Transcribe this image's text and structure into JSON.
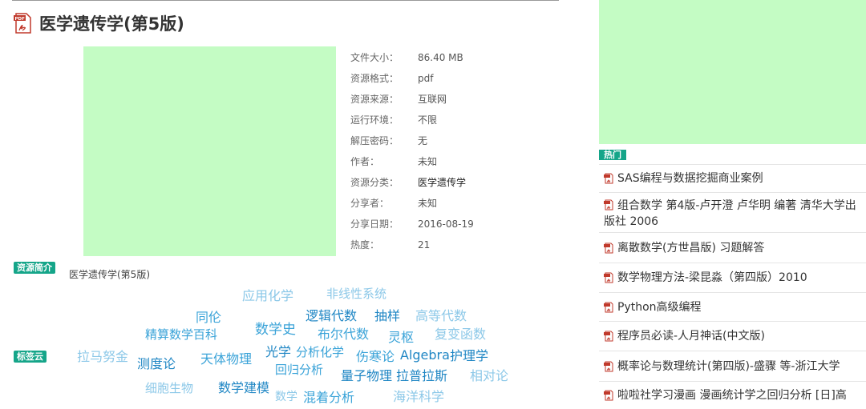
{
  "title": "医学遗传学(第5版)",
  "details": [
    {
      "label": "文件大小：",
      "value": "86.40 MB"
    },
    {
      "label": "资源格式：",
      "value": "pdf"
    },
    {
      "label": "资源来源：",
      "value": "互联网"
    },
    {
      "label": "运行环境：",
      "value": "不限"
    },
    {
      "label": "解压密码：",
      "value": "无"
    },
    {
      "label": "作者：",
      "value": "未知"
    },
    {
      "label": "资源分类：",
      "value": "医学遗传学"
    },
    {
      "label": "分享者：",
      "value": "未知"
    },
    {
      "label": "分享日期：",
      "value": "2016-08-19"
    },
    {
      "label": "热度：",
      "value": "21"
    }
  ],
  "intro": {
    "badge": "资源简介",
    "text": "医学遗传学(第5版)"
  },
  "tagcloud": {
    "badge": "标签云",
    "tags": [
      "应用化学",
      "非线性系统",
      "同伦",
      "逻辑代数",
      "抽样",
      "高等代数",
      "精算数学百科",
      "数学史",
      "布尔代数",
      "灵枢",
      "复变函数",
      "拉马努金",
      "测度论",
      "天体物理",
      "光学",
      "分析化学",
      "伤寒论",
      "Algebra",
      "护理学",
      "回归分析",
      "量子物理",
      "拉普拉斯",
      "相对论",
      "细胞生物",
      "数学建模",
      "数学",
      "混着分析",
      "海洋科学"
    ]
  },
  "sidebar": {
    "hot_badge": "热门",
    "items": [
      "SAS编程与数据挖掘商业案例",
      "组合数学 第4版-卢开澄 卢华明 编著 清华大学出版社 2006",
      "离散数学(方世昌版) 习题解答",
      "数学物理方法-梁昆淼（第四版）2010",
      "Python高级编程",
      "程序员必读-人月神话(中文版)",
      "概率论与数理统计(第四版)-盛骤 等-浙江大学",
      "啦啦社学习漫画 漫画统计学之回归分析 [日]高"
    ]
  },
  "colors": {
    "accent": "#15a589",
    "cloud_light": "#8cc8e8",
    "cloud_mid": "#3aa3d8",
    "cloud_dark": "#1f86c4"
  }
}
